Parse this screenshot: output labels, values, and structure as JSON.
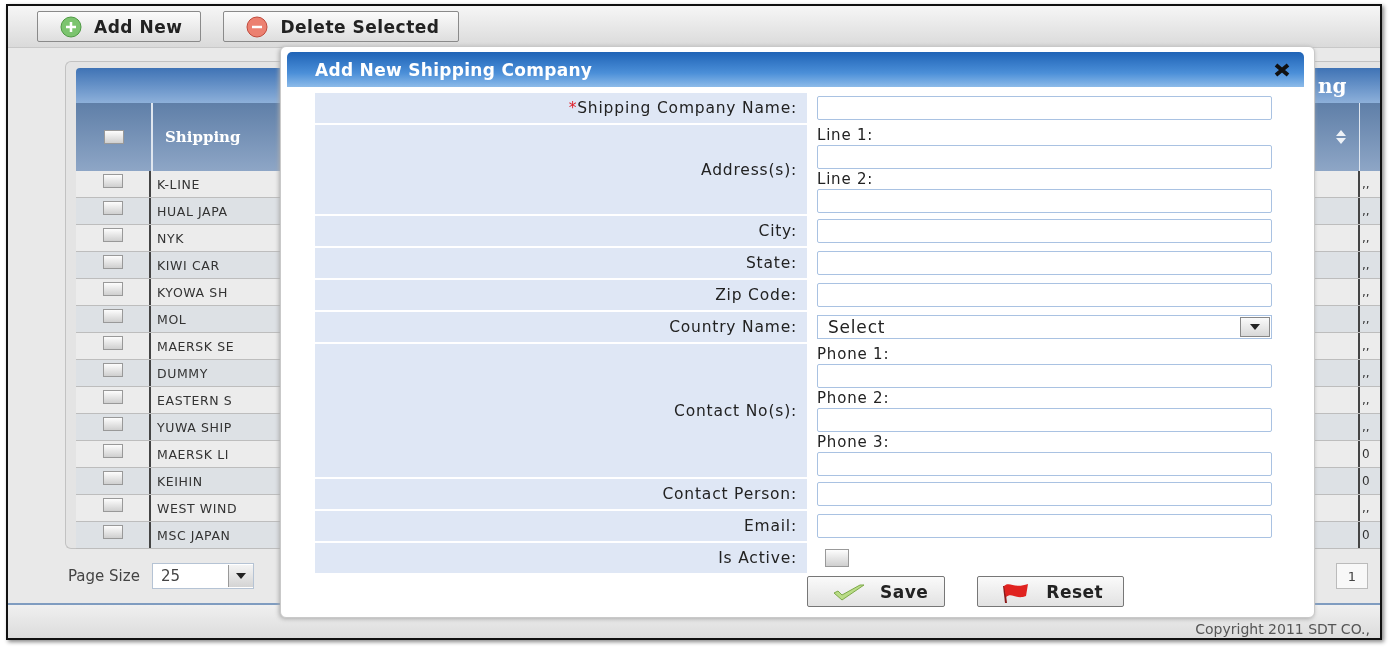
{
  "toolbar": {
    "buttons": [
      {
        "label": "Add New",
        "kind": "add"
      },
      {
        "label": "Delete Selected",
        "kind": "delete"
      }
    ]
  },
  "grid": {
    "title": "ng",
    "select_all": {
      "checked": false
    },
    "columns": [
      "Shipping"
    ],
    "rows": [
      {
        "name": "K-LINE",
        "column_3": ",,",
        "checked": false
      },
      {
        "name": "HUAL JAPA",
        "column_3": ",,",
        "checked": false
      },
      {
        "name": "NYK",
        "column_3": ",,",
        "checked": false
      },
      {
        "name": "KIWI CAR",
        "column_3": ",,",
        "checked": false
      },
      {
        "name": "KYOWA SH",
        "column_3": ",,",
        "checked": false
      },
      {
        "name": "MOL",
        "column_3": ",,",
        "checked": false
      },
      {
        "name": "MAERSK SE",
        "column_3": ",,",
        "checked": false
      },
      {
        "name": "DUMMY",
        "column_3": ",,",
        "checked": false
      },
      {
        "name": "EASTERN S",
        "column_3": ",,",
        "checked": false
      },
      {
        "name": "YUWA SHIP",
        "column_3": ",,",
        "checked": false
      },
      {
        "name": "MAERSK LI",
        "column_3": "0",
        "checked": false
      },
      {
        "name": "KEIHIN",
        "column_3": "0",
        "checked": false
      },
      {
        "name": "WEST WIND",
        "column_3": ",,",
        "checked": false
      },
      {
        "name": "MSC JAPAN",
        "column_3": "0",
        "checked": false
      }
    ]
  },
  "pager": {
    "page_size_label": "Page Size",
    "page_size": "25",
    "page": "1"
  },
  "footer": {
    "copyright": "Copyright 2011 SDT CO.,"
  },
  "dialog": {
    "title": "Add New Shipping Company",
    "fields": [
      {
        "kind": "text",
        "label": "Shipping Company Name:",
        "required_mark": "*"
      },
      {
        "kind": "multi",
        "label": "Address(s):",
        "lines": [
          "Line 1:",
          "Line 2:"
        ]
      },
      {
        "kind": "text",
        "label": "City:"
      },
      {
        "kind": "text",
        "label": "State:"
      },
      {
        "kind": "text",
        "label": "Zip Code:"
      },
      {
        "kind": "select",
        "label": "Country Name:",
        "value": "Select"
      },
      {
        "kind": "multi",
        "label": "Contact No(s):",
        "lines": [
          "Phone 1:",
          "Phone 2:",
          "Phone 3:"
        ]
      },
      {
        "kind": "text",
        "label": "Contact Person:"
      },
      {
        "kind": "text",
        "label": "Email:"
      },
      {
        "kind": "checkbox",
        "label": "Is Active:",
        "checked": false
      }
    ],
    "buttons": [
      {
        "label": "Save",
        "kind": "save"
      },
      {
        "label": "Reset",
        "kind": "reset"
      }
    ]
  }
}
